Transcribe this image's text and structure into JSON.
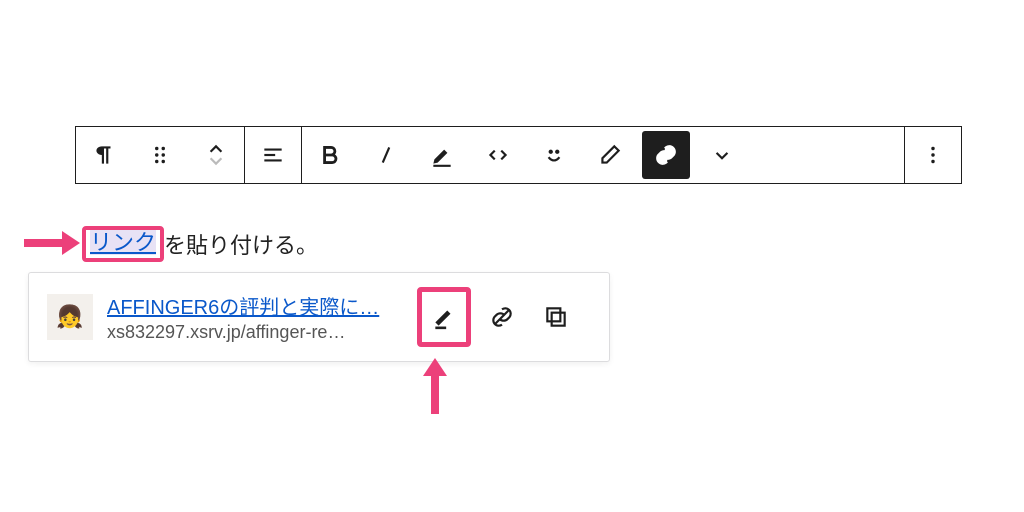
{
  "colors": {
    "accent_pink": "#ec407a",
    "link_blue": "#0a58ca",
    "toolbar_border": "#1e1e1e"
  },
  "toolbar": {
    "groups": [
      [
        "paragraph-icon",
        "drag-handle-icon",
        "move-updown-icon"
      ],
      [
        "align-icon"
      ],
      [
        "bold-icon",
        "italic-icon",
        "highlight-icon",
        "code-icon",
        "emoji-icon",
        "clear-icon",
        "link-icon",
        "chevron-down-icon"
      ],
      [
        "more-icon"
      ]
    ],
    "active": "link-icon"
  },
  "content": {
    "link_text": "リンク",
    "rest_text": "を貼り付ける。"
  },
  "link_popup": {
    "thumbnail_emoji": "👧",
    "title": "AFFINGER6の評判と実際に…",
    "url": "xs832297.xsrv.jp/affinger-re…",
    "actions": [
      "edit-icon",
      "unlink-icon",
      "copy-icon"
    ]
  },
  "annotations": {
    "highlight_link_word": true,
    "highlight_edit_button": true,
    "arrow_to_link_word": true,
    "arrow_to_edit_button": true
  }
}
